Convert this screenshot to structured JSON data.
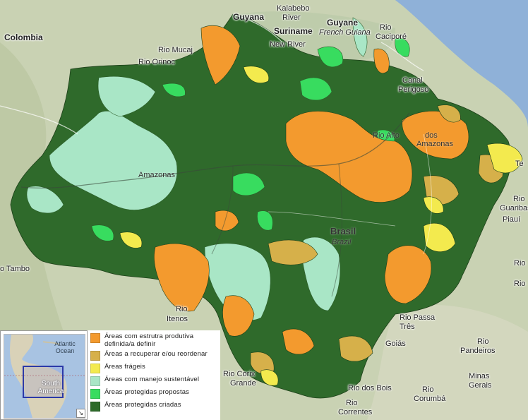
{
  "map": {
    "legend": [
      {
        "label": "Áreas com estrutra produtiva definida/a definir",
        "color": "#f39a2e"
      },
      {
        "label": "Áreas a recuperar e/ou reordenar",
        "color": "#d6b04a"
      },
      {
        "label": "Áreas frágeis",
        "color": "#f3ea4e"
      },
      {
        "label": "Áreas com manejo sustentável",
        "color": "#a9e6c6"
      },
      {
        "label": "Áreas protegidas propostas",
        "color": "#38dc5f"
      },
      {
        "label": "Áreas protegidas criadas",
        "color": "#2e6b2a"
      }
    ],
    "overview": {
      "region_label": "South America",
      "ocean_label": "Atlantic Ocean",
      "toggle_icon": "collapse-arrow-icon"
    },
    "place_labels": {
      "colombia": "Colombia",
      "guyana": "Guyana",
      "kalabebo": "Kalabebo",
      "river1": "River",
      "suriname": "Suriname",
      "guyane": "Guyane",
      "french_guiana": "French Guiana",
      "rio_cacipore": "Rio",
      "cacipore": "Caciporé",
      "new_river": "New River",
      "rio_mucajai": "Rio Mucaj",
      "rio_orinoco": "Rio Orinoc",
      "canal_1": "Canal",
      "canal_2": "Perigoso",
      "amazonas": "Amazonas",
      "brasil": "Brasil",
      "brazil": "Brazil",
      "rio_tambo": "o Tambo",
      "rio_iteno_1": "Rio",
      "rio_iteno_2": "Itenos",
      "rio_passa_tres_1": "Rio Passa",
      "rio_passa_tres_2": "Três",
      "goias": "Goiás",
      "rio_pandeiros_1": "Rio",
      "rio_pandeiros_2": "Pandeiros",
      "rio_corixo_1": "Rio Corix",
      "rio_corixo_2": "Grande",
      "rio_dos_bois": "Rio dos Bois",
      "minas_1": "Minas",
      "minas_2": "Gerais",
      "rio_corumba_1": "Rio",
      "rio_corumba_2": "Corumbá",
      "rio_correntes_1": "Rio",
      "rio_correntes_2": "Correntes",
      "piaui": "Piauí",
      "rio_guaribas_1": "Rio",
      "rio_guaribas_2": "Guaribas",
      "teresina": "Te",
      "rio_right_1": "Rio",
      "rio_right_2": "Rio",
      "dos_right": "dos",
      "amazonas_right": "Amazonas",
      "rio_alto": "Rio Alto"
    }
  }
}
